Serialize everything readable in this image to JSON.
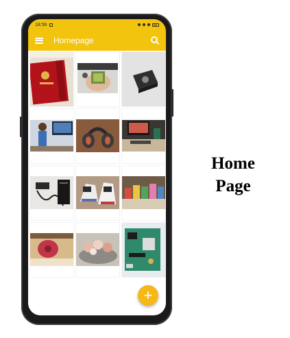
{
  "caption": {
    "line1": "Home",
    "line2": "Page"
  },
  "status_bar": {
    "time": "18:56"
  },
  "app_bar": {
    "title": "Homepage"
  },
  "fab": {
    "symbol": "+"
  },
  "colors": {
    "accent": "#f2c40d",
    "fab": "#f5b817"
  },
  "icons": {
    "menu": "menu-icon",
    "search": "search-icon",
    "add": "add-icon"
  },
  "photos": [
    {
      "subject": "red-book"
    },
    {
      "subject": "electronic-module-in-hand"
    },
    {
      "subject": "black-box"
    },
    {
      "subject": "figurine-with-monitor"
    },
    {
      "subject": "headphones"
    },
    {
      "subject": "computer-desk"
    },
    {
      "subject": "laptop-charger"
    },
    {
      "subject": "sneakers"
    },
    {
      "subject": "small-figures"
    },
    {
      "subject": "red-speaker-on-shelf"
    },
    {
      "subject": "stuffed-toys-in-bowl"
    },
    {
      "subject": "circuit-board"
    }
  ]
}
